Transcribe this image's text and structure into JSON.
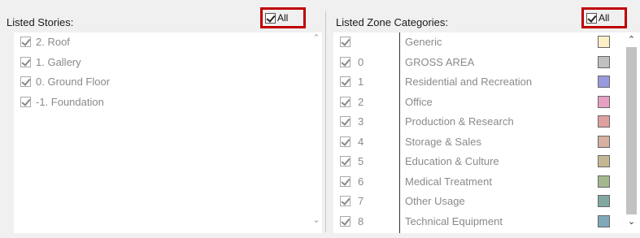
{
  "left": {
    "title": "Listed Stories:",
    "all_label": "All",
    "items": [
      {
        "label": "2. Roof"
      },
      {
        "label": "1. Gallery"
      },
      {
        "label": "0. Ground Floor"
      },
      {
        "label": "-1. Foundation"
      }
    ]
  },
  "right": {
    "title": "Listed Zone Categories:",
    "all_label": "All",
    "items": [
      {
        "code": "",
        "label": "Generic",
        "color": "#fdf0c8"
      },
      {
        "code": "0",
        "label": "GROSS AREA",
        "color": "#c0c0c0"
      },
      {
        "code": "1",
        "label": "Residential and Recreation",
        "color": "#9999e0"
      },
      {
        "code": "2",
        "label": "Office",
        "color": "#e6a0c4"
      },
      {
        "code": "3",
        "label": "Production & Research",
        "color": "#e0a0a0"
      },
      {
        "code": "4",
        "label": "Storage & Sales",
        "color": "#d6b0a0"
      },
      {
        "code": "5",
        "label": "Education & Culture",
        "color": "#c4b894"
      },
      {
        "code": "6",
        "label": "Medical Treatment",
        "color": "#a4b890"
      },
      {
        "code": "7",
        "label": "Other Usage",
        "color": "#80a8a0"
      },
      {
        "code": "8",
        "label": "Technical Equipment",
        "color": "#80a8b8"
      }
    ]
  }
}
